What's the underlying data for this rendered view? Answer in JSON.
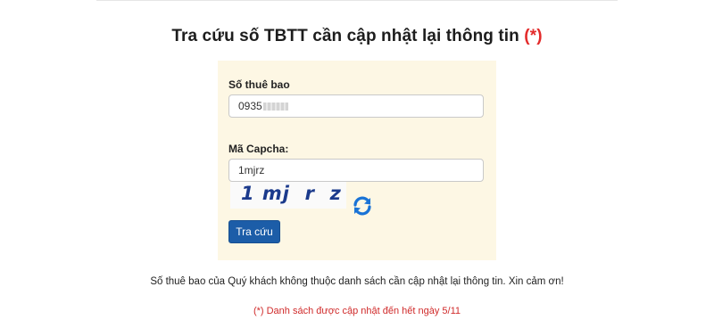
{
  "page": {
    "title": "Tra cứu số TBTT cần cập nhật lại thông tin",
    "title_required_mark": "(*)"
  },
  "form": {
    "phone_label": "Số thuê bao",
    "phone_value": "0935",
    "captcha_label": "Mã Capcha:",
    "captcha_value": "1mjrz",
    "captcha_image_text": "1 mj  r  z",
    "submit_label": "Tra cứu"
  },
  "result": {
    "message": "Số thuê bao của Quý khách không thuộc danh sách cần cập nhật lại thông tin. Xin cảm ơn!",
    "note": "(*) Danh sách được cập nhật đến hết ngày 5/11"
  },
  "colors": {
    "panel_bg": "#fdf7e4",
    "button": "#1c5da8",
    "required": "#e32b2b",
    "refresh_icon": "#1a73d6"
  },
  "icons": {
    "refresh": "refresh-icon"
  }
}
